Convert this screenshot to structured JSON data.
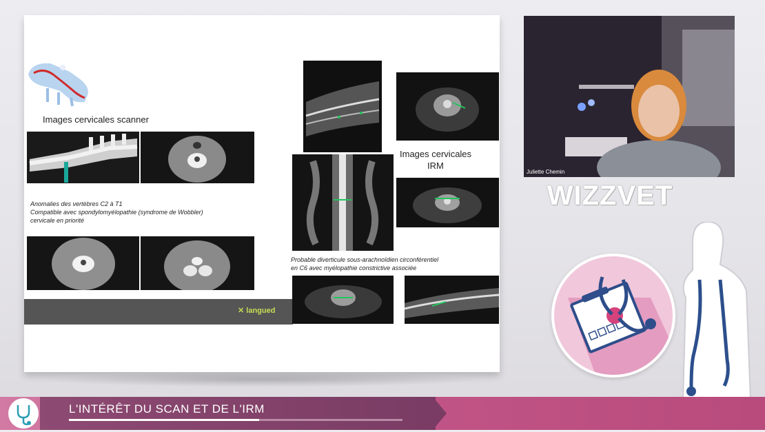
{
  "slide": {
    "scanner_title": "Images cervicales scanner",
    "scanner_caption_lines": [
      "Anomalies des vertèbres C2 à T1",
      "Compatible avec spondylomyélopathie (syndrome de Wobbler)",
      "cervicale en priorité"
    ],
    "irm_title_lines": [
      "Images cervicales",
      "IRM"
    ],
    "irm_caption_lines": [
      "Probable diverticule sous-arachnoïdien circonférentiel",
      "en C6 avec myélopathie constrictive associée"
    ],
    "logo_text": "langued"
  },
  "webcam": {
    "participant_name": "Juliette Chemin"
  },
  "brand": {
    "text": "WIZZVET"
  },
  "footer": {
    "title": "L'INTÉRÊT DU SCAN ET DE L'IRM",
    "progress": 0.57
  },
  "colors": {
    "footer_pink": "#c25587",
    "footer_dark": "#7a3c64",
    "accent_teal": "#1aa89a",
    "bubble_pink": "#f1c7db"
  }
}
